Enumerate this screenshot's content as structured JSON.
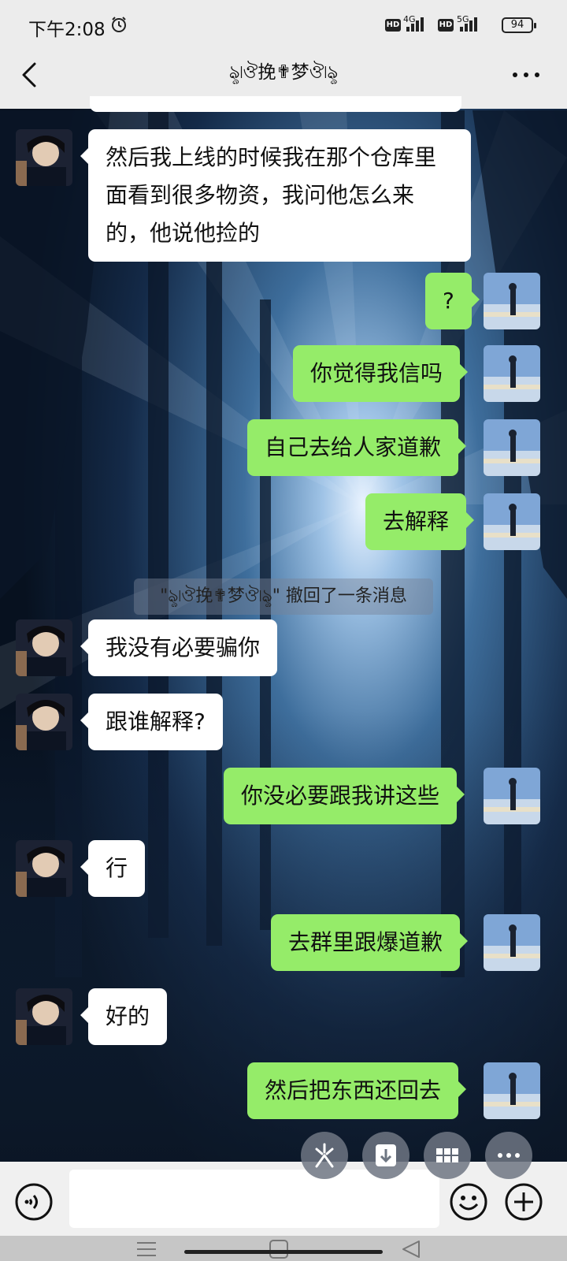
{
  "status_bar": {
    "time": "下午2:08",
    "network_1": "4G",
    "network_2": "5G",
    "battery": "94",
    "hd_label": "HD"
  },
  "header": {
    "title": "ৡ৷ঔ挽✟梦ঔ৷ৡ",
    "back_icon": "chevron-left-icon",
    "more_icon": "more-dots-icon"
  },
  "messages": [
    {
      "side": "in",
      "text": "然后我上线的时候我在那个仓库里面看到很多物资，我问他怎么来的，他说他捡的"
    },
    {
      "side": "out",
      "text": "?"
    },
    {
      "side": "out",
      "text": "你觉得我信吗"
    },
    {
      "side": "out",
      "text": "自己去给人家道歉"
    },
    {
      "side": "out",
      "text": "去解释"
    },
    {
      "side": "system",
      "text": "\"ৡ৷ঔ挽✟梦ঔ৷ৡ\" 撤回了一条消息"
    },
    {
      "side": "in",
      "text": "我没有必要骗你"
    },
    {
      "side": "in",
      "text": "跟谁解释?"
    },
    {
      "side": "out",
      "text": "你没必要跟我讲这些"
    },
    {
      "side": "in",
      "text": "行"
    },
    {
      "side": "out",
      "text": "去群里跟爆道歉"
    },
    {
      "side": "in",
      "text": "好的"
    },
    {
      "side": "out",
      "text": "然后把东西还回去"
    }
  ],
  "floating_actions": [
    "slash-tool-icon",
    "download-icon",
    "grid-icon",
    "more-dots-icon"
  ],
  "input_bar": {
    "voice_icon": "voice-icon",
    "emoji_icon": "emoji-icon",
    "add_icon": "plus-icon"
  },
  "nav_bar": [
    "menu-icon",
    "home-square-icon",
    "back-triangle-icon"
  ],
  "colors": {
    "outgoing_bubble": "#95ec69",
    "incoming_bubble": "#ffffff",
    "header_bg": "#ececec"
  }
}
